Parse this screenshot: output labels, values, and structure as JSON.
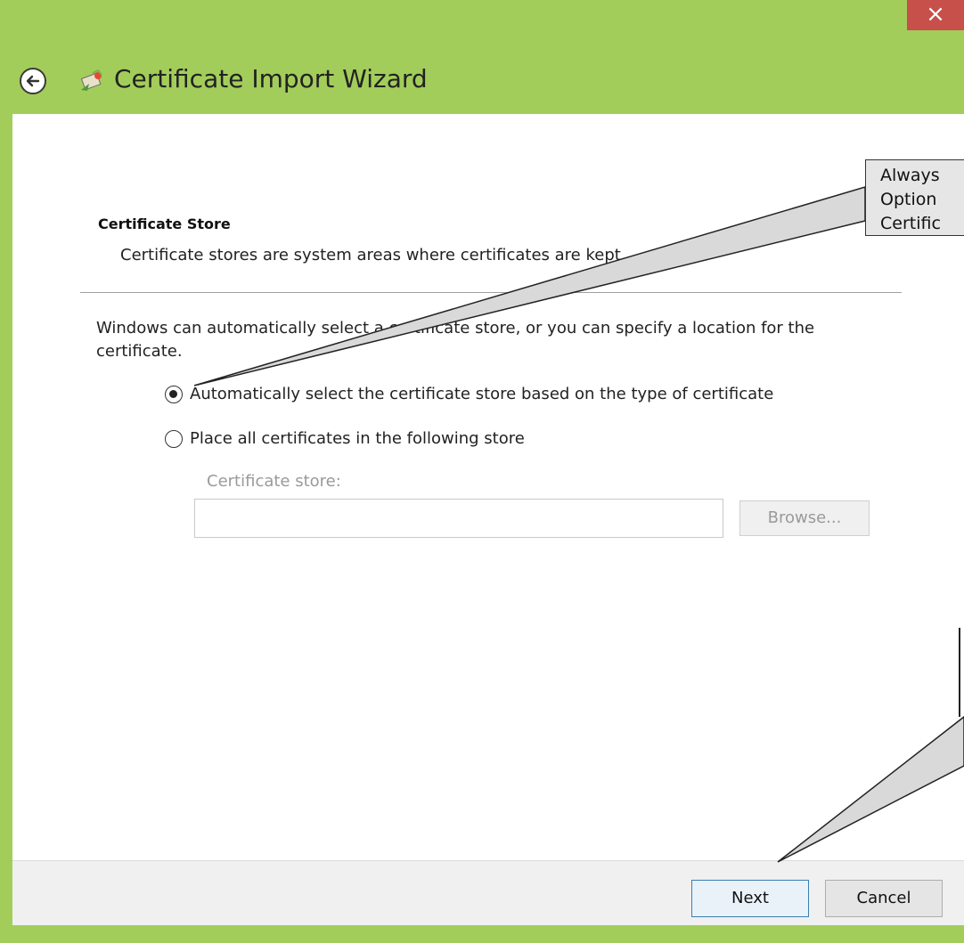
{
  "window": {
    "title": "Certificate Import Wizard",
    "close_glyph": "×",
    "icons": [
      "close-icon",
      "back-arrow-icon",
      "certificate-wizard-icon"
    ]
  },
  "page": {
    "section_title": "Certificate Store",
    "section_description": "Certificate stores are system areas where certificates are kept.",
    "intro_text": "Windows can automatically select a certificate store, or you can specify a location for the certificate.",
    "radio_options": [
      {
        "label": "Automatically select the certificate store based on the type of certificate",
        "checked": true
      },
      {
        "label": "Place all certificates in the following store",
        "checked": false
      }
    ],
    "store_label": "Certificate store:",
    "store_value": "",
    "browse_label": "Browse..."
  },
  "footer": {
    "next_label": "Next",
    "cancel_label": "Cancel"
  },
  "callout": {
    "lines": [
      "Always",
      "Option",
      "Certific"
    ]
  },
  "colors": {
    "frame": "#a3cd5a",
    "close": "#c7504a",
    "next_border": "#3c7fb1"
  }
}
